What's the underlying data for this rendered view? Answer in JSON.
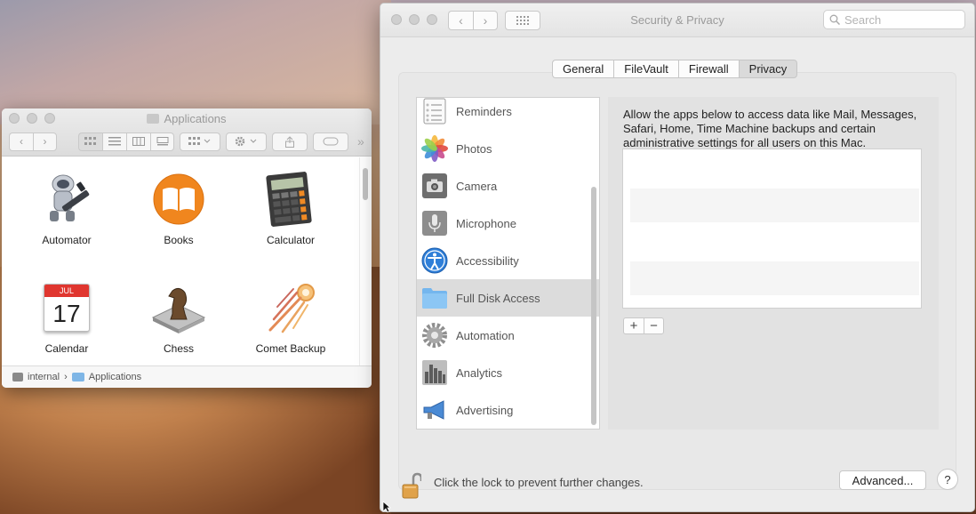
{
  "finder": {
    "title": "Applications",
    "apps": [
      {
        "label": "Automator",
        "icon": "automator-icon"
      },
      {
        "label": "Books",
        "icon": "books-icon"
      },
      {
        "label": "Calculator",
        "icon": "calculator-icon"
      },
      {
        "label": "Calendar",
        "icon": "calendar-icon",
        "month": "JUL",
        "day": "17"
      },
      {
        "label": "Chess",
        "icon": "chess-icon"
      },
      {
        "label": "Comet Backup",
        "icon": "comet-backup-icon"
      }
    ],
    "path": [
      "internal",
      "Applications"
    ],
    "path_separator": "›"
  },
  "prefs": {
    "title": "Security & Privacy",
    "search_placeholder": "Search",
    "tabs": [
      {
        "label": "General",
        "active": false
      },
      {
        "label": "FileVault",
        "active": false
      },
      {
        "label": "Firewall",
        "active": false
      },
      {
        "label": "Privacy",
        "active": true
      }
    ],
    "services": [
      {
        "label": "Reminders",
        "icon": "reminders-icon"
      },
      {
        "label": "Photos",
        "icon": "photos-icon"
      },
      {
        "label": "Camera",
        "icon": "camera-icon"
      },
      {
        "label": "Microphone",
        "icon": "microphone-icon"
      },
      {
        "label": "Accessibility",
        "icon": "accessibility-icon"
      },
      {
        "label": "Full Disk Access",
        "icon": "folder-icon",
        "selected": true
      },
      {
        "label": "Automation",
        "icon": "gear-icon"
      },
      {
        "label": "Analytics",
        "icon": "analytics-icon"
      },
      {
        "label": "Advertising",
        "icon": "megaphone-icon"
      }
    ],
    "description": "Allow the apps below to access data like Mail, Messages, Safari, Home, Time Machine backups and certain administrative settings for all users on this Mac.",
    "add_label": "+",
    "remove_label": "−",
    "lock_text": "Click the lock to prevent further changes.",
    "advanced_label": "Advanced...",
    "help_label": "?"
  },
  "colors": {
    "selected_row": "#dcdcdc",
    "folder_blue": "#7fb6e6",
    "books_orange": "#f0861e",
    "calendar_red": "#e0362f"
  }
}
